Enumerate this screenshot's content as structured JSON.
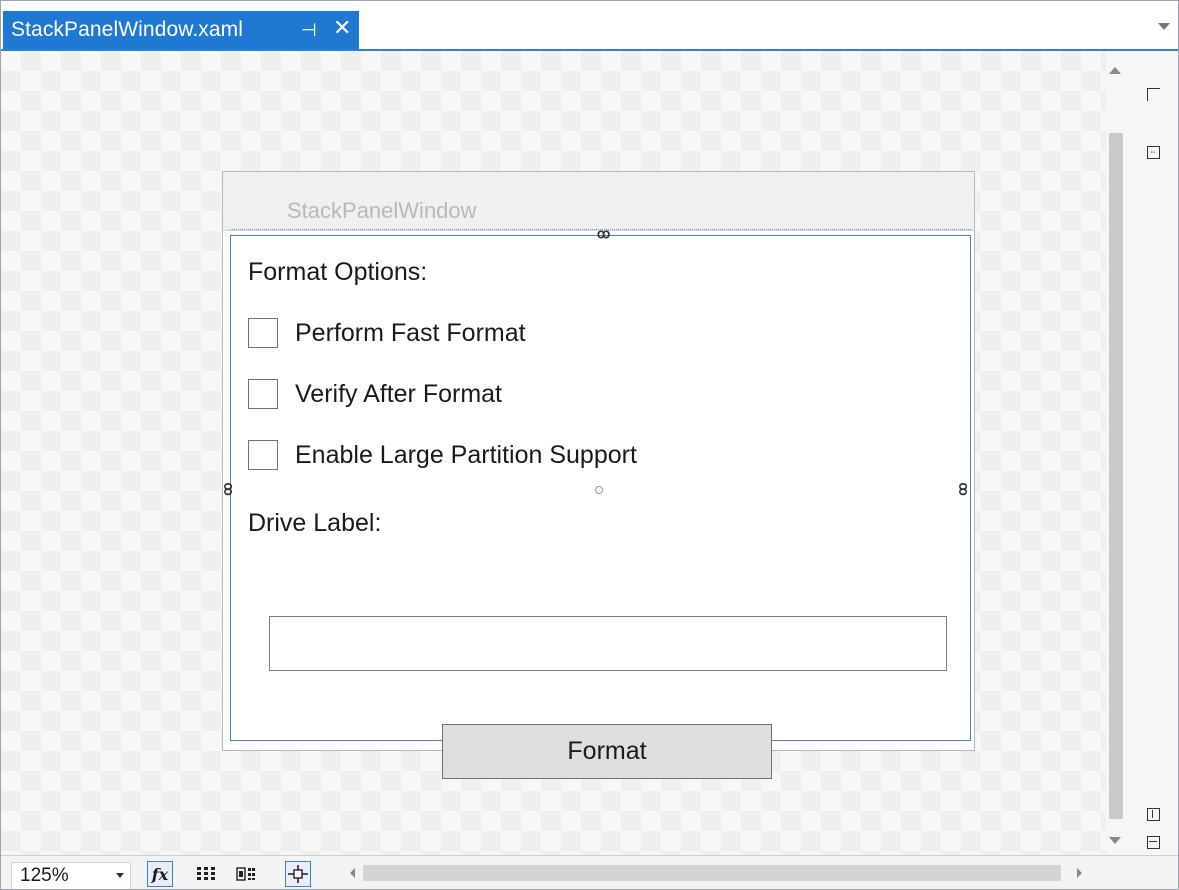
{
  "tab": {
    "title": "StackPanelWindow.xaml",
    "pin_glyph": "⊣",
    "close_glyph": "✕"
  },
  "window": {
    "title": "StackPanelWindow",
    "format_options_label": "Format Options:",
    "checkboxes": [
      {
        "label": "Perform Fast Format",
        "checked": false
      },
      {
        "label": "Verify After Format",
        "checked": false
      },
      {
        "label": "Enable Large Partition Support",
        "checked": false
      }
    ],
    "drive_label": "Drive Label:",
    "drive_label_value": "",
    "format_button": "Format"
  },
  "toolbar": {
    "zoom": "125%",
    "fx_label": "fx"
  },
  "colors": {
    "accent": "#1f78d1",
    "selection": "#4a80d8"
  }
}
